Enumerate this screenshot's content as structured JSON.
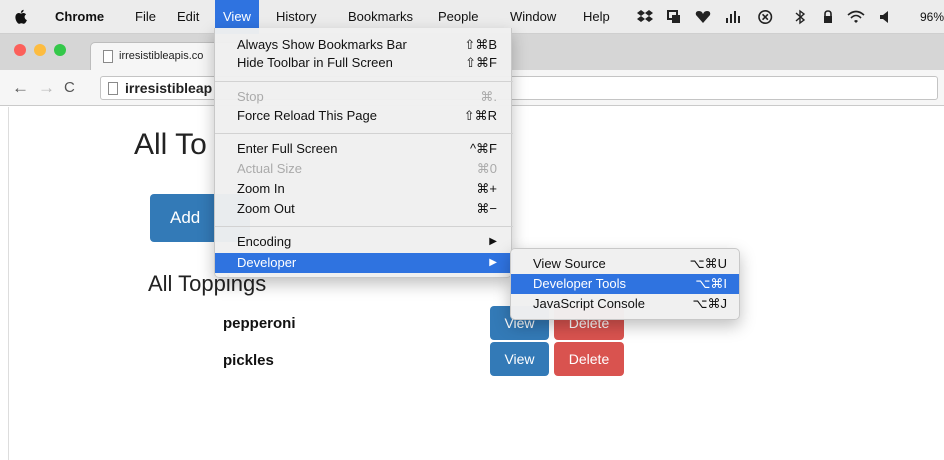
{
  "menubar": {
    "app_name": "Chrome",
    "items": [
      "File",
      "Edit",
      "View",
      "History",
      "Bookmarks",
      "People",
      "Window",
      "Help"
    ],
    "active_item": "View",
    "battery": "96%"
  },
  "browser": {
    "tab_title": "irresistibleapis.co",
    "url": "irresistibleap"
  },
  "page": {
    "heading": "All To",
    "add_button": "Add",
    "subheading": "All Toppings",
    "rows": [
      {
        "name": "pepperoni",
        "view": "View",
        "delete": "Delete"
      },
      {
        "name": "pickles",
        "view": "View",
        "delete": "Delete"
      }
    ]
  },
  "view_menu": {
    "items": [
      {
        "label": "Always Show Bookmarks Bar",
        "shortcut": "⇧⌘B"
      },
      {
        "label": "Hide Toolbar in Full Screen",
        "shortcut": "⇧⌘F"
      },
      {
        "label": "Stop",
        "shortcut": "⌘."
      },
      {
        "label": "Force Reload This Page",
        "shortcut": "⇧⌘R"
      },
      {
        "label": "Enter Full Screen",
        "shortcut": "^⌘F"
      },
      {
        "label": "Actual Size",
        "shortcut": "⌘0"
      },
      {
        "label": "Zoom In",
        "shortcut": "⌘+"
      },
      {
        "label": "Zoom Out",
        "shortcut": "⌘−"
      },
      {
        "label": "Encoding",
        "shortcut": ""
      },
      {
        "label": "Developer",
        "shortcut": ""
      }
    ]
  },
  "developer_menu": {
    "items": [
      {
        "label": "View Source",
        "shortcut": "⌥⌘U"
      },
      {
        "label": "Developer Tools",
        "shortcut": "⌥⌘I"
      },
      {
        "label": "JavaScript Console",
        "shortcut": "⌥⌘J"
      }
    ]
  },
  "colors": {
    "menu_highlight": "#2f73e0",
    "primary_button": "#337ab7",
    "danger_button": "#d9534f"
  }
}
